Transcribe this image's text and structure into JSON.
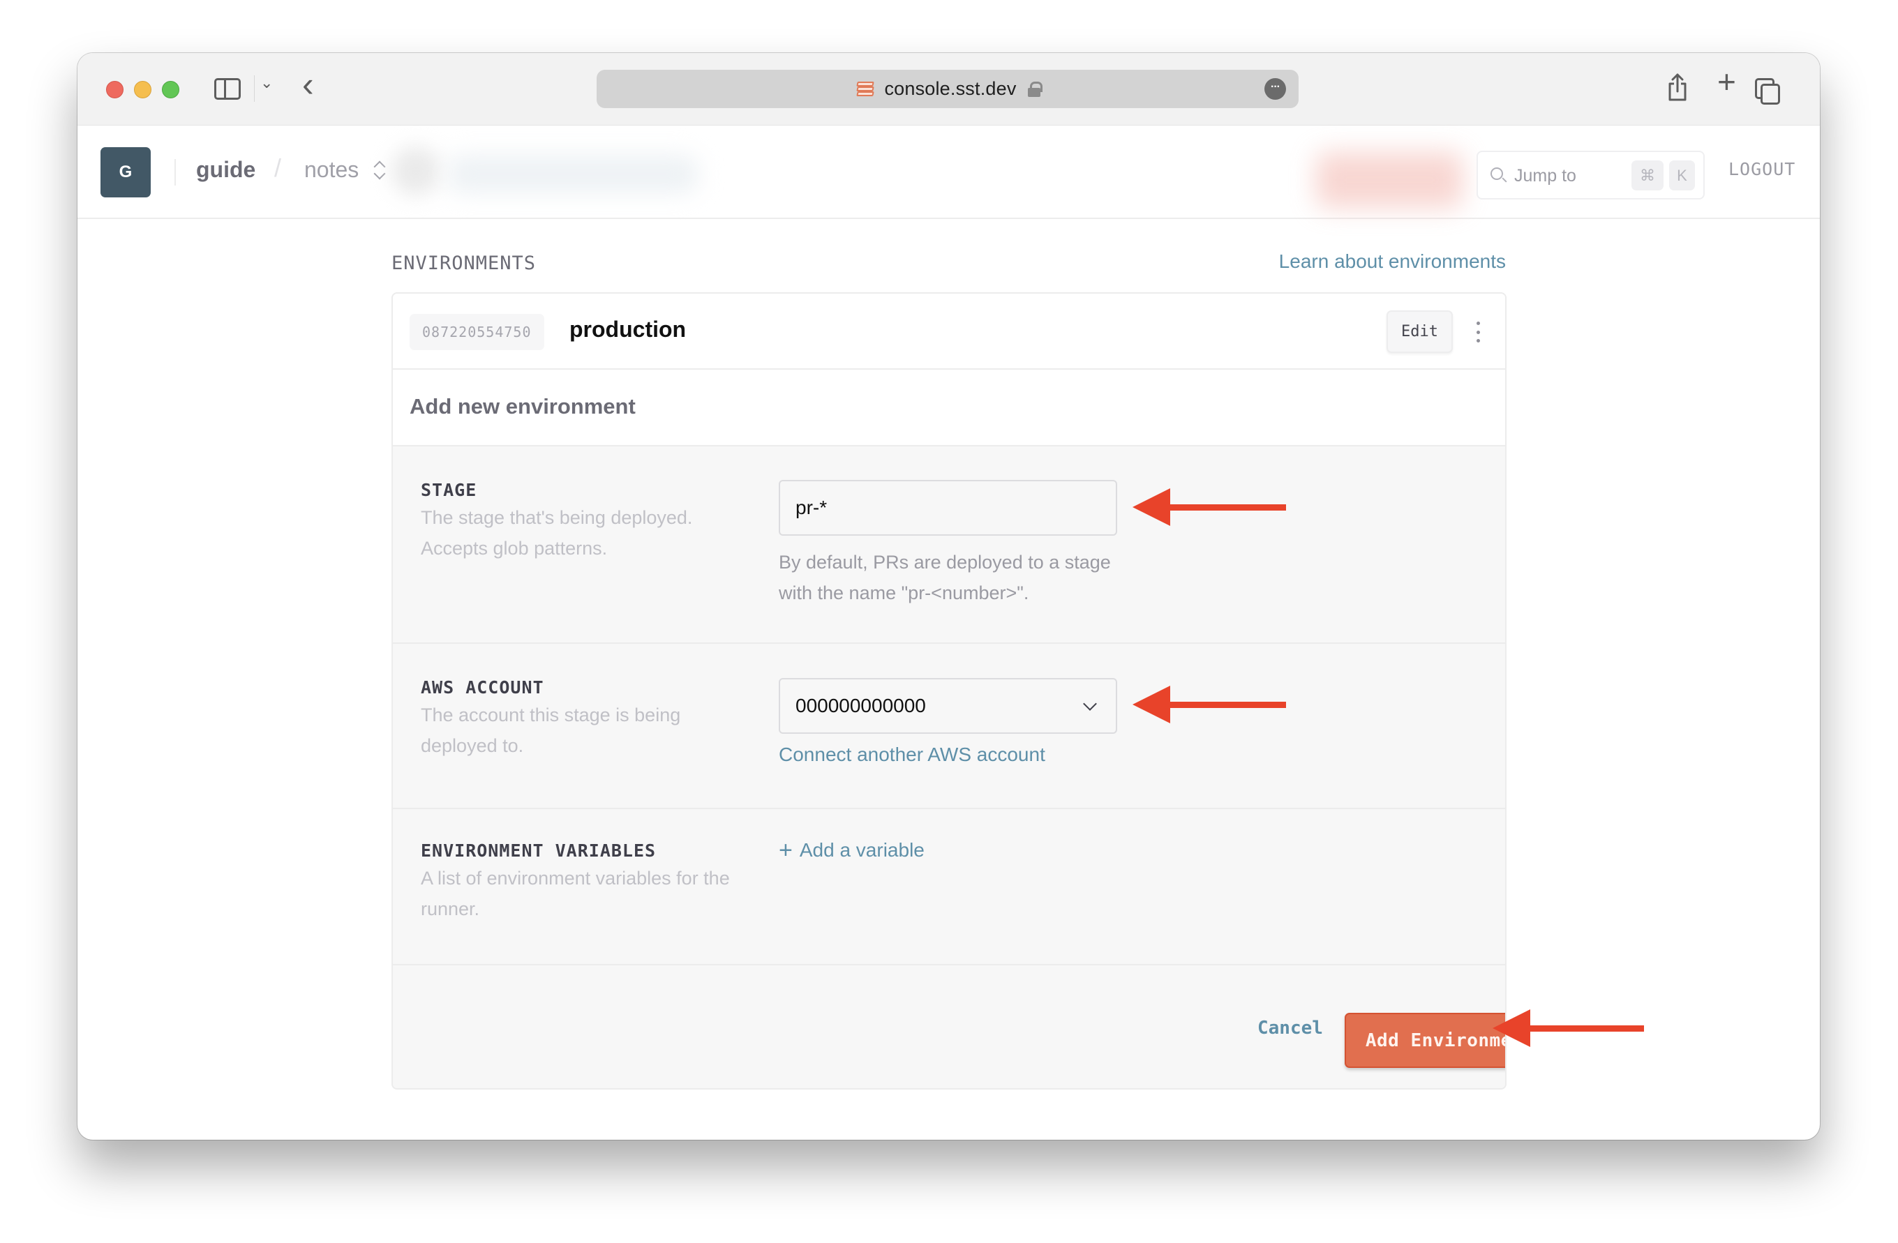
{
  "browser": {
    "url": "console.sst.dev",
    "secure": true,
    "favicon": "sst-logo-icon",
    "toolbar_icons": [
      "sidebar-toggle-icon",
      "chevron-down-icon",
      "back-icon",
      "share-icon",
      "new-tab-icon",
      "tab-overview-icon"
    ]
  },
  "header": {
    "avatar_initial": "G",
    "org": "guide",
    "separator": "/",
    "app": "notes",
    "search": {
      "placeholder": "Jump to",
      "shortcut_mod": "⌘",
      "shortcut_key": "K"
    },
    "logout_label": "LOGOUT"
  },
  "environments": {
    "title": "ENVIRONMENTS",
    "learn_link": "Learn about environments",
    "existing": [
      {
        "account_id": "087220554750",
        "name": "production",
        "edit_label": "Edit"
      }
    ],
    "new_form": {
      "title": "Add new environment",
      "stage": {
        "label": "STAGE",
        "description": "The stage that's being deployed. Accepts glob patterns.",
        "value": "pr-*",
        "hint": "By default, PRs are deployed to a stage with the name \"pr-<number>\"."
      },
      "aws_account": {
        "label": "AWS ACCOUNT",
        "description": "The account this stage is being deployed to.",
        "selected": "000000000000",
        "connect_link": "Connect another AWS account"
      },
      "env_vars": {
        "label": "ENVIRONMENT VARIABLES",
        "description": "A list of environment variables for the runner.",
        "add_label": "Add a variable"
      },
      "cancel_label": "Cancel",
      "submit_label": "Add Environment"
    }
  },
  "colors": {
    "accent": "#e16f4f",
    "link": "#5e8fa8",
    "annotation_arrow": "#e8432a",
    "avatar_bg": "#425866"
  }
}
